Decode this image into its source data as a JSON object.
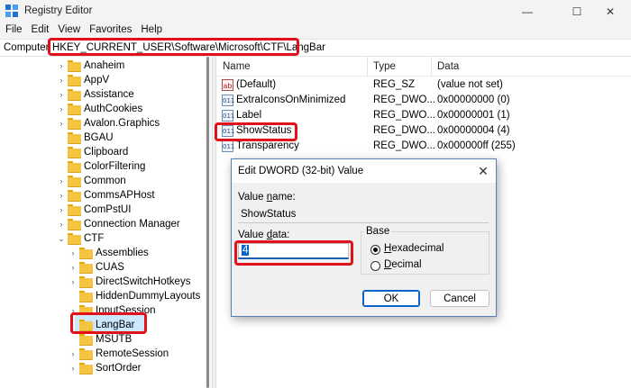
{
  "window": {
    "title": "Registry Editor",
    "controls": {
      "minimize": "—",
      "maximize": "☐",
      "close": "✕"
    }
  },
  "menu": [
    "File",
    "Edit",
    "View",
    "Favorites",
    "Help"
  ],
  "address": {
    "prefix": "Computer",
    "path": "HKEY_CURRENT_USER\\Software\\Microsoft\\CTF\\LangBar"
  },
  "tree": {
    "items": [
      {
        "label": "Anaheim",
        "expander": "›"
      },
      {
        "label": "AppV",
        "expander": "›"
      },
      {
        "label": "Assistance",
        "expander": "›"
      },
      {
        "label": "AuthCookies",
        "expander": "›"
      },
      {
        "label": "Avalon.Graphics",
        "expander": "›"
      },
      {
        "label": "BGAU",
        "expander": ""
      },
      {
        "label": "Clipboard",
        "expander": ""
      },
      {
        "label": "ColorFiltering",
        "expander": ""
      },
      {
        "label": "Common",
        "expander": "›"
      },
      {
        "label": "CommsAPHost",
        "expander": "›"
      },
      {
        "label": "ComPstUI",
        "expander": "›"
      },
      {
        "label": "Connection Manager",
        "expander": "›"
      },
      {
        "label": "CTF",
        "expander": "⌄"
      },
      {
        "label": "Assemblies",
        "expander": "›"
      },
      {
        "label": "CUAS",
        "expander": "›"
      },
      {
        "label": "DirectSwitchHotkeys",
        "expander": "›"
      },
      {
        "label": "HiddenDummyLayouts",
        "expander": ""
      },
      {
        "label": "InputSession",
        "expander": "›"
      },
      {
        "label": "LangBar",
        "expander": ""
      },
      {
        "label": "MSUTB",
        "expander": ""
      },
      {
        "label": "RemoteSession",
        "expander": "›"
      },
      {
        "label": "SortOrder",
        "expander": "›"
      }
    ]
  },
  "list": {
    "headers": {
      "name": "Name",
      "type": "Type",
      "data": "Data"
    },
    "rows": [
      {
        "icon": "string-value-icon",
        "glyph": "ab",
        "name": "(Default)",
        "type": "REG_SZ",
        "data": "(value not set)"
      },
      {
        "icon": "dword-value-icon",
        "glyph": "011",
        "name": "ExtraIconsOnMinimized",
        "type": "REG_DWO...",
        "data": "0x00000000 (0)"
      },
      {
        "icon": "dword-value-icon",
        "glyph": "011",
        "name": "Label",
        "type": "REG_DWO...",
        "data": "0x00000001 (1)"
      },
      {
        "icon": "dword-value-icon",
        "glyph": "011",
        "name": "ShowStatus",
        "type": "REG_DWO...",
        "data": "0x00000004 (4)"
      },
      {
        "icon": "dword-value-icon",
        "glyph": "011",
        "name": "Transparency",
        "type": "REG_DWO...",
        "data": "0x000000ff (255)"
      }
    ]
  },
  "dialog": {
    "title": "Edit DWORD (32-bit) Value",
    "close": "✕",
    "value_name_label_pre": "Value ",
    "value_name_label_acc": "n",
    "value_name_label_post": "ame:",
    "value_name": "ShowStatus",
    "value_data_label_pre": "Value ",
    "value_data_label_acc": "d",
    "value_data_label_post": "ata:",
    "value_data": "4",
    "base_label": "Base",
    "hex_acc": "H",
    "hex_rest": "exadecimal",
    "dec_acc": "D",
    "dec_rest": "ecimal",
    "base_selected": "Hexadecimal",
    "ok": "OK",
    "cancel": "Cancel"
  },
  "colors": {
    "highlight": "#e2101a",
    "selection": "#cce8ff",
    "accent": "#0a64c8"
  }
}
